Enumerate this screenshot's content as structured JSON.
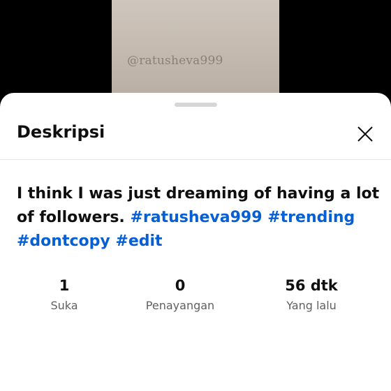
{
  "video": {
    "watermark": "@ratusheva999"
  },
  "sheet": {
    "title": "Deskripsi",
    "close_icon": "close-icon"
  },
  "description": {
    "text": "I think I was just dreaming of having a lot of followers. ",
    "hashtags": [
      "#ratusheva999",
      "#trending",
      "#dontcopy",
      "#edit"
    ]
  },
  "stats": {
    "likes": {
      "value": "1",
      "label": "Suka"
    },
    "views": {
      "value": "0",
      "label": "Penayangan"
    },
    "time": {
      "value": "56 dtk",
      "label": "Yang lalu"
    }
  },
  "colors": {
    "hashtag": "#065fd4",
    "text_primary": "#0f0f0f",
    "text_secondary": "#606060",
    "background": "#000000",
    "sheet": "#ffffff"
  }
}
